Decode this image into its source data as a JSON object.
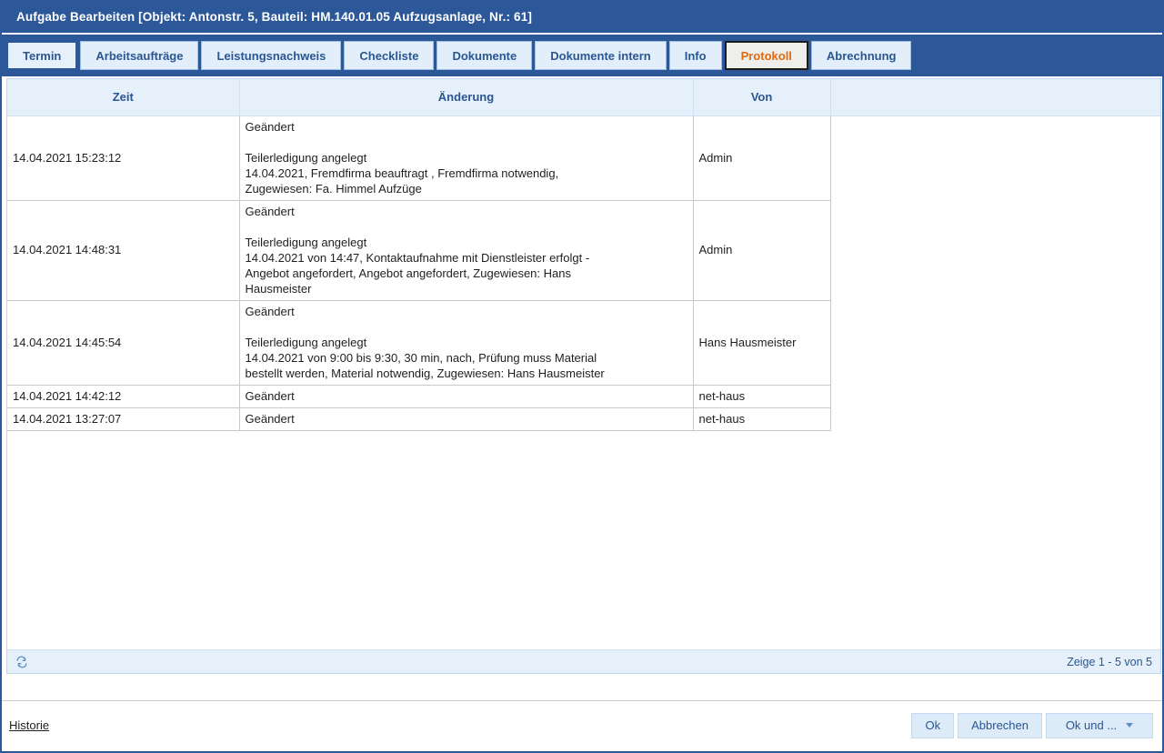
{
  "window": {
    "title": "Aufgabe Bearbeiten [Objekt: Antonstr. 5, Bauteil: HM.140.01.05 Aufzugsanlage, Nr.: 61]",
    "colors": {
      "titlebar_bg": "#2c5899",
      "tab_bg": "#e3eefb",
      "tab_text": "#2a5691",
      "active_tab_text": "#e06a10",
      "header_bg": "#e5f0fa",
      "button_bg": "#ddeaf7"
    }
  },
  "tabs": [
    {
      "label": "Termin",
      "state": "focused"
    },
    {
      "label": "Arbeitsaufträge",
      "state": "normal"
    },
    {
      "label": "Leistungsnachweis",
      "state": "normal"
    },
    {
      "label": "Checkliste",
      "state": "normal"
    },
    {
      "label": "Dokumente",
      "state": "normal"
    },
    {
      "label": "Dokumente intern",
      "state": "normal"
    },
    {
      "label": "Info",
      "state": "normal"
    },
    {
      "label": "Protokoll",
      "state": "active"
    },
    {
      "label": "Abrechnung",
      "state": "normal"
    }
  ],
  "grid": {
    "columns": [
      "Zeit",
      "Änderung",
      "Von",
      ""
    ],
    "rows": [
      {
        "zeit": "14.04.2021 15:23:12",
        "aenderung_head": "Geändert",
        "aenderung_lines": [
          "Teilerledigung angelegt",
          "14.04.2021, Fremdfirma beauftragt , Fremdfirma notwendig,",
          "Zugewiesen: Fa. Himmel Aufzüge"
        ],
        "von": "Admin"
      },
      {
        "zeit": "14.04.2021 14:48:31",
        "aenderung_head": "Geändert",
        "aenderung_lines": [
          "Teilerledigung angelegt",
          "14.04.2021 von 14:47, Kontaktaufnahme mit Dienstleister erfolgt -",
          "Angebot angefordert, Angebot angefordert, Zugewiesen: Hans",
          "Hausmeister"
        ],
        "von": "Admin"
      },
      {
        "zeit": "14.04.2021 14:45:54",
        "aenderung_head": "Geändert",
        "aenderung_lines": [
          "Teilerledigung angelegt",
          "14.04.2021 von 9:00 bis 9:30, 30 min, nach, Prüfung muss Material",
          "bestellt werden, Material notwendig, Zugewiesen: Hans Hausmeister"
        ],
        "von": "Hans Hausmeister"
      },
      {
        "zeit": "14.04.2021 14:42:12",
        "aenderung_head": "Geändert",
        "aenderung_lines": [],
        "von": "net-haus"
      },
      {
        "zeit": "14.04.2021 13:27:07",
        "aenderung_head": "Geändert",
        "aenderung_lines": [],
        "von": "net-haus"
      }
    ]
  },
  "pager": {
    "refresh_icon": "refresh-icon",
    "text": "Zeige 1 - 5 von 5"
  },
  "footer": {
    "history_link": "Historie",
    "ok_label": "Ok",
    "cancel_label": "Abbrechen",
    "ok_and_label": "Ok und ...",
    "dropdown_icon": "chevron-down-icon"
  }
}
